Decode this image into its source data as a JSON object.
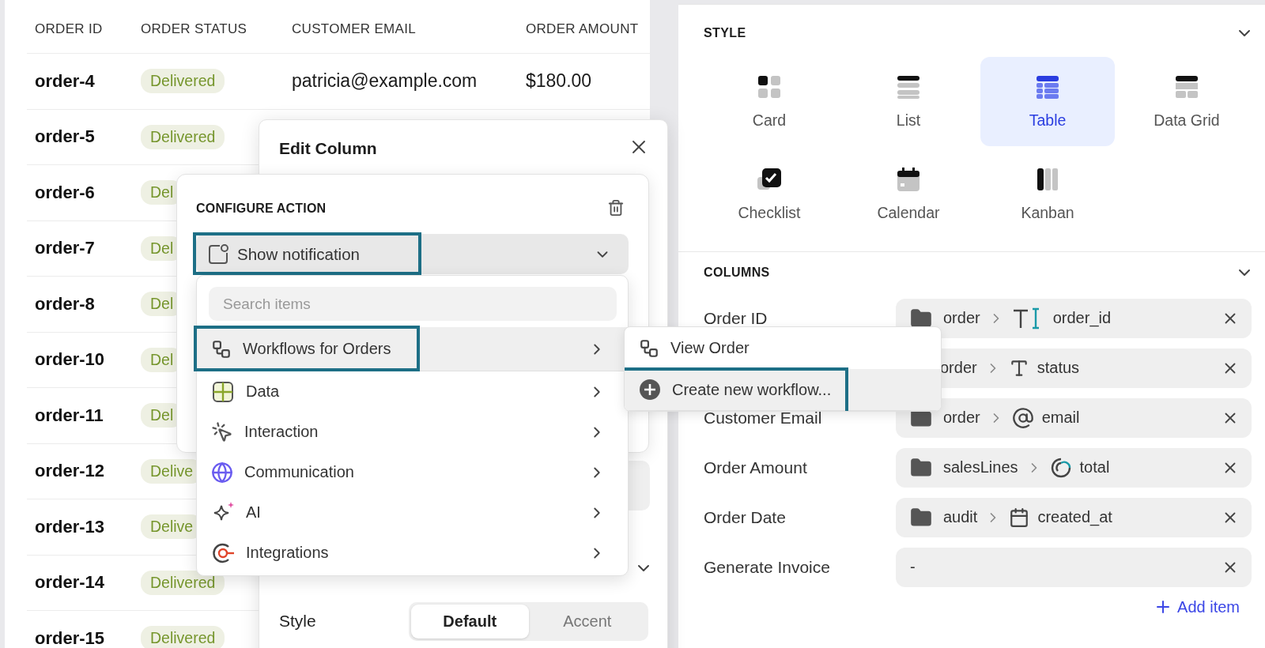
{
  "table": {
    "columns": [
      "ORDER ID",
      "ORDER STATUS",
      "CUSTOMER EMAIL",
      "ORDER AMOUNT"
    ],
    "rows": [
      {
        "id": "order-4",
        "status": "Delivered",
        "email": "patricia@example.com",
        "amount": "$180.00"
      },
      {
        "id": "order-5",
        "status": "Delivered"
      },
      {
        "id": "order-6",
        "status": "Del"
      },
      {
        "id": "order-7",
        "status": "Del"
      },
      {
        "id": "order-8",
        "status": "Del"
      },
      {
        "id": "order-10",
        "status": "Del"
      },
      {
        "id": "order-11",
        "status": "Del"
      },
      {
        "id": "order-12",
        "status": "Delive"
      },
      {
        "id": "order-13",
        "status": "Delive"
      },
      {
        "id": "order-14",
        "status": "Delivered"
      },
      {
        "id": "order-15",
        "status": "Delivered"
      }
    ]
  },
  "style_panel": {
    "title": "STYLE",
    "options": [
      {
        "kind": "card",
        "label": "Card",
        "selected": false
      },
      {
        "kind": "list",
        "label": "List",
        "selected": false
      },
      {
        "kind": "table",
        "label": "Table",
        "selected": true
      },
      {
        "kind": "datagrid",
        "label": "Data Grid",
        "selected": false
      },
      {
        "kind": "checklist",
        "label": "Checklist",
        "selected": false
      },
      {
        "kind": "calendar",
        "label": "Calendar",
        "selected": false
      },
      {
        "kind": "kanban",
        "label": "Kanban",
        "selected": false
      }
    ]
  },
  "columns_panel": {
    "title": "COLUMNS",
    "rows": [
      {
        "label": "Order ID",
        "folder": true,
        "source": "order",
        "kind": "text",
        "field": "order_id"
      },
      {
        "folder": false,
        "source": "order",
        "kind": "type",
        "field": "status"
      },
      {
        "label": "Customer Email",
        "folder": true,
        "source": "order",
        "kind": "email",
        "field": "email"
      },
      {
        "label": "Order Amount",
        "folder": true,
        "source": "salesLines",
        "kind": "number",
        "field": "total"
      },
      {
        "label": "Order Date",
        "folder": true,
        "source": "audit",
        "kind": "date",
        "field": "created_at"
      },
      {
        "label": "Generate Invoice",
        "value": "-"
      }
    ],
    "add_label": "Add item"
  },
  "edit_column": {
    "title": "Edit Column",
    "style_label": "Style",
    "segments": [
      {
        "label": "Default",
        "selected": true
      },
      {
        "label": "Accent",
        "selected": false
      }
    ]
  },
  "configure_action": {
    "title": "CONFIGURE ACTION",
    "action": {
      "label": "Show notification",
      "annotated": true
    },
    "search": {
      "placeholder": "Search items"
    },
    "items": [
      {
        "kind": "workflow",
        "label": "Workflows for Orders",
        "selected": true,
        "annotated": true
      },
      {
        "kind": "data",
        "label": "Data",
        "selected": false,
        "annotated": false
      },
      {
        "kind": "interaction",
        "label": "Interaction",
        "selected": false,
        "annotated": false
      },
      {
        "kind": "communication",
        "label": "Communication",
        "selected": false,
        "annotated": false
      },
      {
        "kind": "ai",
        "label": "AI",
        "selected": false,
        "annotated": false
      },
      {
        "kind": "integrations",
        "label": "Integrations",
        "selected": false,
        "annotated": false
      }
    ]
  },
  "submenu": {
    "items": [
      {
        "kind": "workflow",
        "label": "View Order",
        "selected": false,
        "annotated": false
      },
      {
        "kind": "create",
        "label": "Create new workflow...",
        "selected": true,
        "annotated": true
      }
    ]
  }
}
